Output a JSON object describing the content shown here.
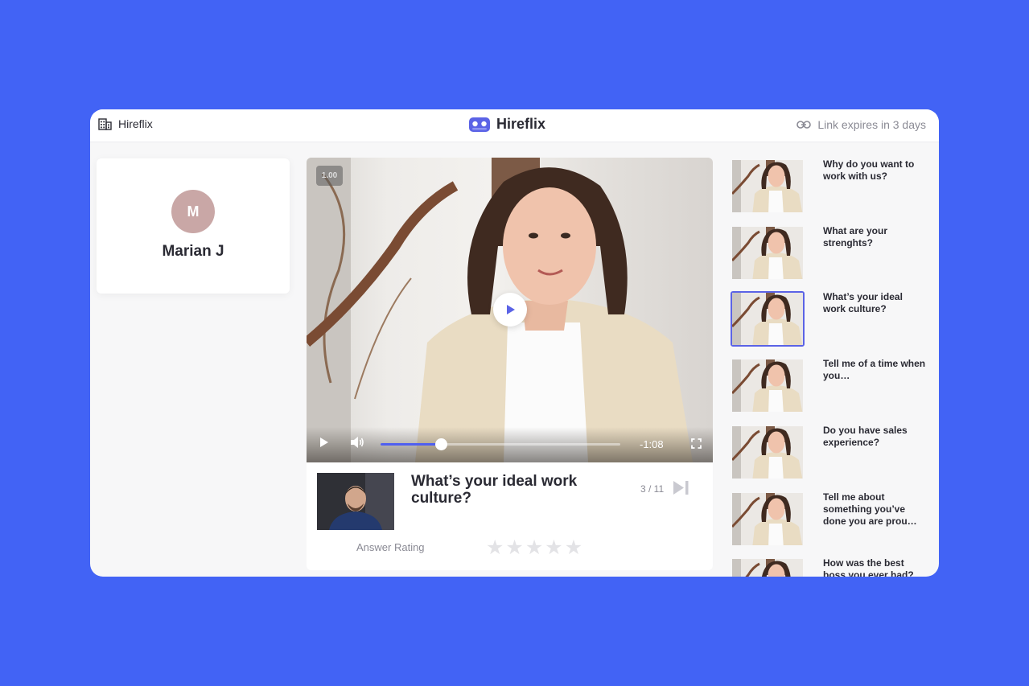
{
  "header": {
    "company_name": "Hireflix",
    "brand_name": "Hireflix",
    "expiry_text": "Link expires in 3 days"
  },
  "candidate": {
    "initial": "M",
    "name": "Marian J"
  },
  "player": {
    "speed": "1.00",
    "time_remaining": "-1:08",
    "progress": 0.25
  },
  "answer": {
    "question": "What’s your ideal work culture?",
    "counter": "3 / 11",
    "rating_label": "Answer Rating",
    "rating": 0,
    "max_rating": 5
  },
  "questions": [
    {
      "text": "Why do you want to work with us?",
      "active": false
    },
    {
      "text": "What are your strenghts?",
      "active": false
    },
    {
      "text": "What’s your ideal work culture?",
      "active": true
    },
    {
      "text": "Tell me of a time when you…",
      "active": false
    },
    {
      "text": "Do you have sales experience?",
      "active": false
    },
    {
      "text": "Tell me about something you’ve done you are prou…",
      "active": false
    },
    {
      "text": "How was the best boss you ever had?",
      "active": false
    }
  ],
  "colors": {
    "background": "#4263f5",
    "accent": "#4f5ff0",
    "avatar": "#c9a7a6"
  },
  "icons": {
    "company": "building-icon",
    "brand": "hireflix-logo-icon",
    "link": "link-icon",
    "play": "play-icon",
    "volume": "volume-icon",
    "fullscreen": "fullscreen-icon",
    "next": "skip-next-icon",
    "star": "star-icon"
  }
}
